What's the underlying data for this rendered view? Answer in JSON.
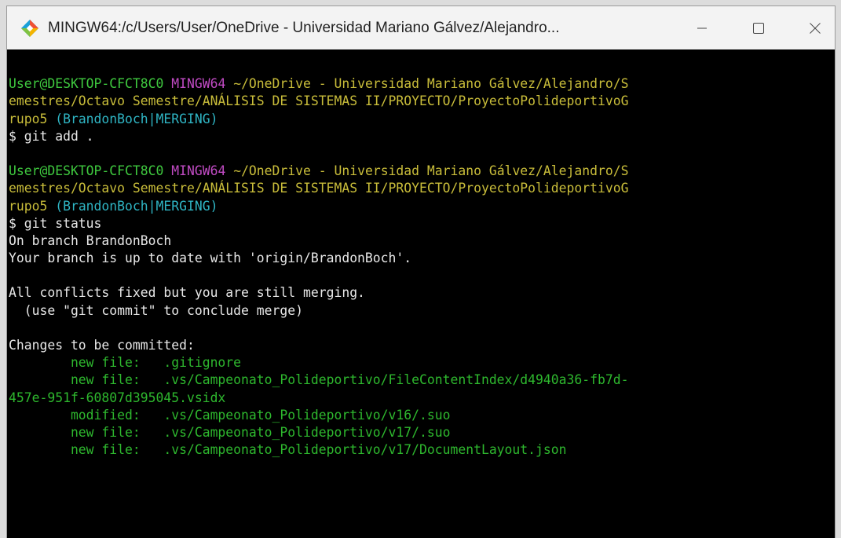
{
  "window": {
    "title": "MINGW64:/c/Users/User/OneDrive - Universidad Mariano Gálvez/Alejandro...",
    "icon": "git-bash-icon",
    "controls": {
      "minimize": "—",
      "maximize": "☐",
      "close": "✕"
    }
  },
  "colors": {
    "user_host": "#3fca3f",
    "msystem": "#c14bc4",
    "path": "#c9bd3a",
    "branch": "#2fb5c4",
    "staged": "#2eb82e",
    "text": "#e8e8e8"
  },
  "terminal": {
    "lines": [
      {
        "kind": "blank",
        "segments": []
      },
      {
        "kind": "prompt",
        "segments": [
          {
            "t": "User@DESKTOP-CFCT8C0",
            "c": "c-green"
          },
          {
            "t": " ",
            "c": "c-white"
          },
          {
            "t": "MINGW64",
            "c": "c-purple"
          },
          {
            "t": " ~/OneDrive - Universidad Mariano Gálvez/Alejandro/S",
            "c": "c-yellow"
          }
        ]
      },
      {
        "kind": "prompt",
        "segments": [
          {
            "t": "emestres/Octavo Semestre/ANÁLISIS DE SISTEMAS II/PROYECTO/ProyectoPolideportivoG",
            "c": "c-yellow"
          }
        ]
      },
      {
        "kind": "prompt",
        "segments": [
          {
            "t": "rupo5",
            "c": "c-yellow"
          },
          {
            "t": " (BrandonBoch|MERGING)",
            "c": "c-cyan"
          }
        ]
      },
      {
        "kind": "command",
        "segments": [
          {
            "t": "$ git add .",
            "c": "c-white"
          }
        ]
      },
      {
        "kind": "blank",
        "segments": []
      },
      {
        "kind": "prompt",
        "segments": [
          {
            "t": "User@DESKTOP-CFCT8C0",
            "c": "c-green"
          },
          {
            "t": " ",
            "c": "c-white"
          },
          {
            "t": "MINGW64",
            "c": "c-purple"
          },
          {
            "t": " ~/OneDrive - Universidad Mariano Gálvez/Alejandro/S",
            "c": "c-yellow"
          }
        ]
      },
      {
        "kind": "prompt",
        "segments": [
          {
            "t": "emestres/Octavo Semestre/ANÁLISIS DE SISTEMAS II/PROYECTO/ProyectoPolideportivoG",
            "c": "c-yellow"
          }
        ]
      },
      {
        "kind": "prompt",
        "segments": [
          {
            "t": "rupo5",
            "c": "c-yellow"
          },
          {
            "t": " (BrandonBoch|MERGING)",
            "c": "c-cyan"
          }
        ]
      },
      {
        "kind": "command",
        "segments": [
          {
            "t": "$ git status",
            "c": "c-white"
          }
        ]
      },
      {
        "kind": "output",
        "segments": [
          {
            "t": "On branch BrandonBoch",
            "c": "c-white"
          }
        ]
      },
      {
        "kind": "output",
        "segments": [
          {
            "t": "Your branch is up to date with 'origin/BrandonBoch'.",
            "c": "c-white"
          }
        ]
      },
      {
        "kind": "blank",
        "segments": []
      },
      {
        "kind": "output",
        "segments": [
          {
            "t": "All conflicts fixed but you are still merging.",
            "c": "c-white"
          }
        ]
      },
      {
        "kind": "output",
        "segments": [
          {
            "t": "  (use \"git commit\" to conclude merge)",
            "c": "c-white"
          }
        ]
      },
      {
        "kind": "blank",
        "segments": []
      },
      {
        "kind": "output",
        "segments": [
          {
            "t": "Changes to be committed:",
            "c": "c-white"
          }
        ]
      },
      {
        "kind": "change",
        "segments": [
          {
            "t": "        new file:   .gitignore",
            "c": "c-change"
          }
        ]
      },
      {
        "kind": "change",
        "segments": [
          {
            "t": "        new file:   .vs/Campeonato_Polideportivo/FileContentIndex/d4940a36-fb7d-",
            "c": "c-change"
          }
        ]
      },
      {
        "kind": "change",
        "segments": [
          {
            "t": "457e-951f-60807d395045.vsidx",
            "c": "c-change"
          }
        ]
      },
      {
        "kind": "change",
        "segments": [
          {
            "t": "        modified:   .vs/Campeonato_Polideportivo/v16/.suo",
            "c": "c-change"
          }
        ]
      },
      {
        "kind": "change",
        "segments": [
          {
            "t": "        new file:   .vs/Campeonato_Polideportivo/v17/.suo",
            "c": "c-change"
          }
        ]
      },
      {
        "kind": "change",
        "segments": [
          {
            "t": "        new file:   .vs/Campeonato_Polideportivo/v17/DocumentLayout.json",
            "c": "c-change"
          }
        ]
      }
    ]
  }
}
